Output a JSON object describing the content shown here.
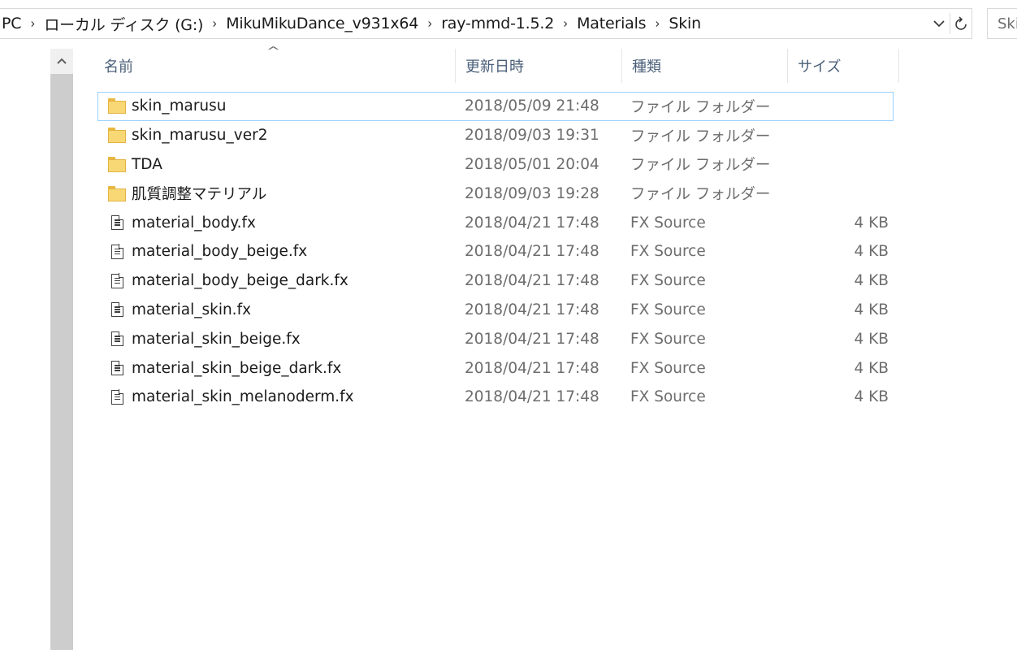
{
  "address_bar": {
    "crumbs": [
      "PC",
      "ローカル ディスク (G:)",
      "MikuMikuDance_v931x64",
      "ray-mmd-1.5.2",
      "Materials",
      "Skin"
    ],
    "search_placeholder": "Skin"
  },
  "columns": {
    "name": "名前",
    "date": "更新日時",
    "type": "種類",
    "size": "サイズ"
  },
  "files": [
    {
      "name": "skin_marusu",
      "date": "2018/05/09 21:48",
      "type": "ファイル フォルダー",
      "size": "",
      "icon": "folder-icon",
      "selected": true
    },
    {
      "name": "skin_marusu_ver2",
      "date": "2018/09/03 19:31",
      "type": "ファイル フォルダー",
      "size": "",
      "icon": "folder-icon",
      "selected": false
    },
    {
      "name": "TDA",
      "date": "2018/05/01 20:04",
      "type": "ファイル フォルダー",
      "size": "",
      "icon": "folder-icon",
      "selected": false
    },
    {
      "name": "肌質調整マテリアル",
      "date": "2018/09/03 19:28",
      "type": "ファイル フォルダー",
      "size": "",
      "icon": "folder-icon",
      "selected": false
    },
    {
      "name": "material_body.fx",
      "date": "2018/04/21 17:48",
      "type": "FX Source",
      "size": "4 KB",
      "icon": "file-icon",
      "selected": false
    },
    {
      "name": "material_body_beige.fx",
      "date": "2018/04/21 17:48",
      "type": "FX Source",
      "size": "4 KB",
      "icon": "file-icon",
      "selected": false
    },
    {
      "name": "material_body_beige_dark.fx",
      "date": "2018/04/21 17:48",
      "type": "FX Source",
      "size": "4 KB",
      "icon": "file-icon",
      "selected": false
    },
    {
      "name": "material_skin.fx",
      "date": "2018/04/21 17:48",
      "type": "FX Source",
      "size": "4 KB",
      "icon": "file-icon",
      "selected": false
    },
    {
      "name": "material_skin_beige.fx",
      "date": "2018/04/21 17:48",
      "type": "FX Source",
      "size": "4 KB",
      "icon": "file-icon",
      "selected": false
    },
    {
      "name": "material_skin_beige_dark.fx",
      "date": "2018/04/21 17:48",
      "type": "FX Source",
      "size": "4 KB",
      "icon": "file-icon",
      "selected": false
    },
    {
      "name": "material_skin_melanoderm.fx",
      "date": "2018/04/21 17:48",
      "type": "FX Source",
      "size": "4 KB",
      "icon": "file-icon",
      "selected": false
    }
  ],
  "colors": {
    "selection_border": "#99d1ff",
    "header_text": "#4c607a",
    "secondary_text": "#6d6d6d",
    "folder": "#f8d775"
  }
}
